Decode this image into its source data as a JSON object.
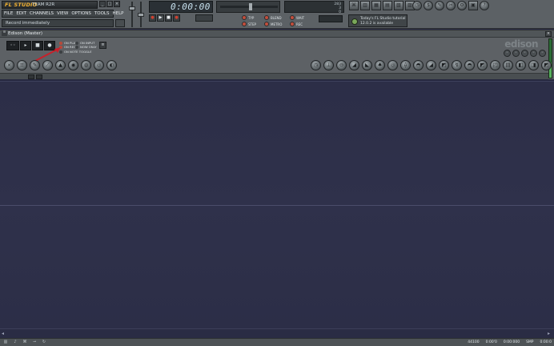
{
  "app": {
    "logo_text": "FL STUDIO",
    "team_text": "TEAM R2R",
    "window_buttons": [
      "_",
      "□",
      "×"
    ]
  },
  "menu": {
    "items": [
      "FILE",
      "EDIT",
      "CHANNELS",
      "VIEW",
      "OPTIONS",
      "TOOLS",
      "HELP"
    ]
  },
  "hint": {
    "text": "Record immediately"
  },
  "transport": {
    "time": "0:00:00",
    "buttons": [
      "●",
      "▶",
      "■",
      "●"
    ]
  },
  "monitor2": {
    "lines": [
      "283",
      "3",
      "0"
    ]
  },
  "options": [
    {
      "label": "TYP"
    },
    {
      "label": "STEP"
    },
    {
      "label": "BLEND"
    },
    {
      "label": "METRO"
    },
    {
      "label": "WAIT"
    },
    {
      "label": "REC"
    }
  ],
  "news": {
    "line1": "Today's FL Studio tutorial",
    "line2": "12.0.2 is available"
  },
  "toolbar_top_icons": [
    "link-icon",
    "piano-icon",
    "mixer-icon",
    "playlist-icon",
    "browser-icon",
    "plugin-icon",
    "cpu-icon",
    "help-icon"
  ],
  "toolbar_right_icons": [
    "tempo-icon",
    "dollar-icon",
    "wrench-icon",
    "scissors-icon",
    "gear-icon",
    "disk-icon",
    "question-icon"
  ],
  "edison": {
    "title": "Edison (Master)",
    "logo": "edison",
    "close": "×",
    "menu_glyph": "≡",
    "ctrl_buttons": [
      "◦◦",
      "▸",
      "■",
      "●"
    ],
    "mode_options": [
      {
        "label": "ON PLAY",
        "on": true
      },
      {
        "label": "ON INPUT",
        "on": false
      },
      {
        "label": "ON REC",
        "on": true
      },
      {
        "label": "NOW ONLY",
        "on": false
      },
      {
        "label": "ON NOTE TOGGLE",
        "on": false
      }
    ],
    "small_btn": "≡",
    "zoom_buttons": [
      "◦",
      "◦",
      "◦",
      "◦",
      "◦"
    ],
    "vu_level": 0.4,
    "tools_left": [
      "×",
      "≡",
      "✎",
      "⟋",
      "▲",
      "◉",
      "◍",
      "◎",
      "◐"
    ],
    "tools_right": [
      "◷",
      "⊥",
      "⊖",
      "◢",
      "◣",
      "♠",
      "◎",
      "⟠",
      "◓",
      "◢",
      "◩",
      "↯",
      "◓",
      "◩",
      "◰",
      "▤",
      "◧",
      "◨",
      "◩"
    ]
  },
  "bottom": {
    "status_icons": [
      "piano-icon",
      "note-icon",
      "link-icon",
      "plug-icon",
      "loop-icon"
    ],
    "readouts": [
      "44100",
      "0:00'0",
      "0:00:000",
      "SMP",
      "0:00:0"
    ]
  }
}
